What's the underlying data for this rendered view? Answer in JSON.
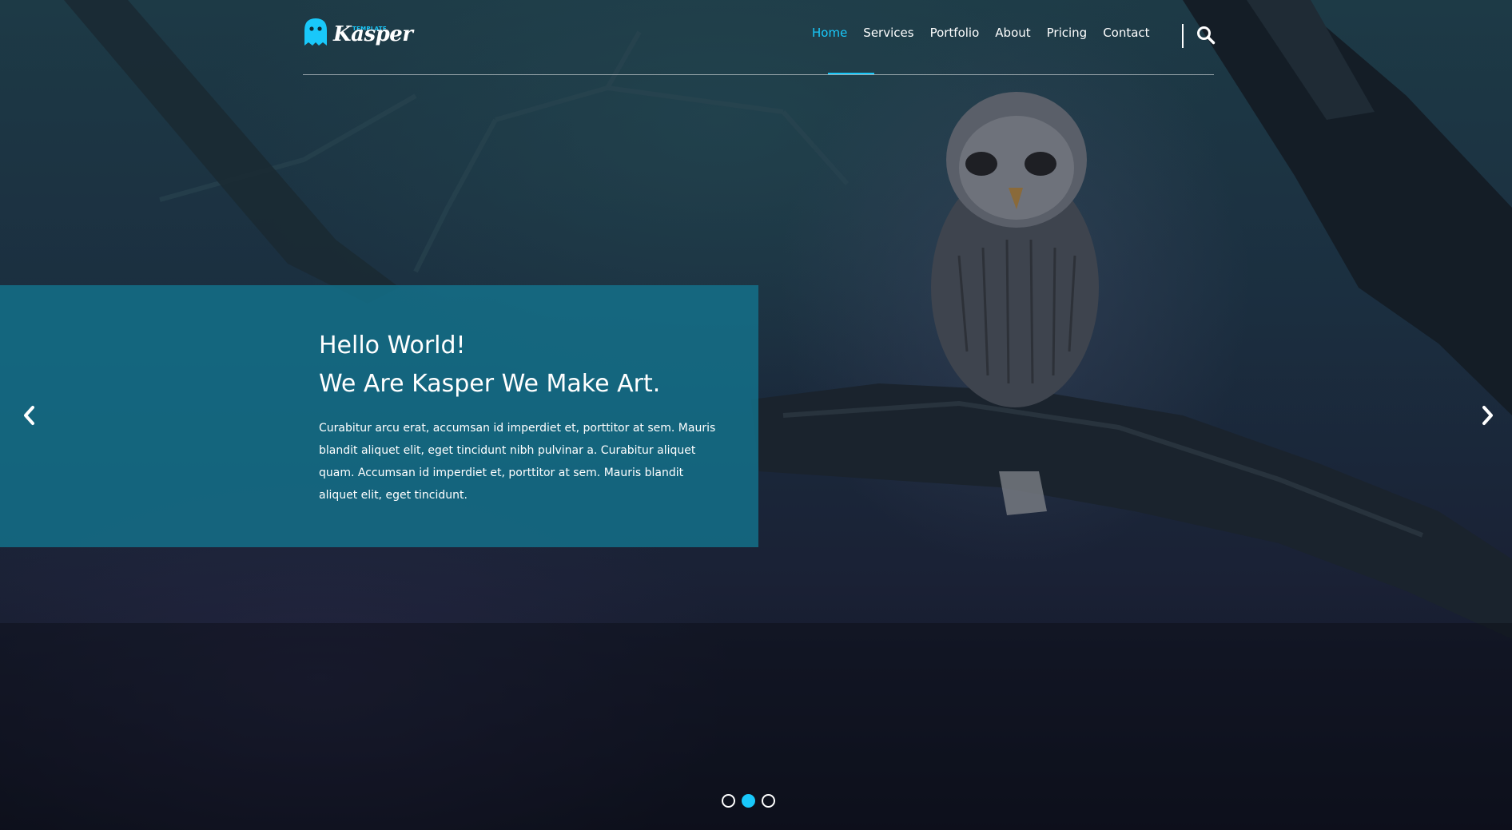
{
  "brand": {
    "name": "Kasper",
    "tagline": "TEMPLATE",
    "accent_color": "#19c8fa"
  },
  "nav": {
    "items": [
      {
        "label": "Home",
        "active": true
      },
      {
        "label": "Services"
      },
      {
        "label": "Portfolio"
      },
      {
        "label": "About"
      },
      {
        "label": "Pricing"
      },
      {
        "label": "Contact"
      }
    ],
    "search_icon": "search-icon"
  },
  "hero": {
    "title_line1": "Hello World!",
    "title_line2": "We Are Kasper We Make Art.",
    "text": "Curabitur arcu erat, accumsan id imperdiet et, porttitor at sem. Mauris blandit aliquet elit, eget tincidunt nibh pulvinar a. Curabitur aliquet quam. Accumsan id imperdiet et, porttitor at sem. Mauris blandit aliquet elit, eget tincidunt.",
    "prev_icon": "chevron-left-icon",
    "next_icon": "chevron-right-icon"
  },
  "slider": {
    "count": 3,
    "active_index": 1
  }
}
